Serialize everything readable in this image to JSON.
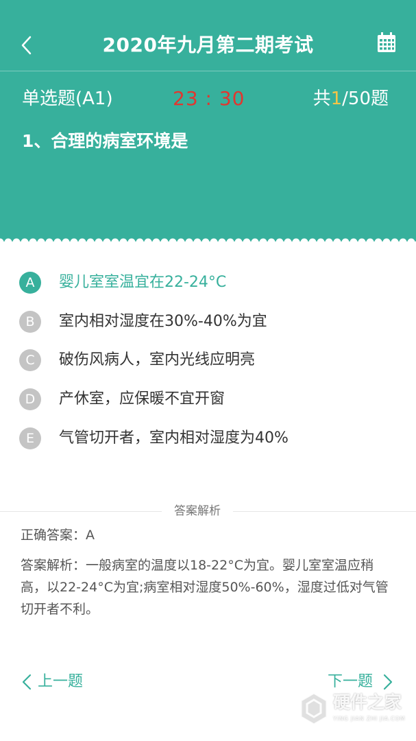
{
  "header": {
    "title": "2020年九月第二期考试",
    "question_type": "单选题(A1)",
    "timer": "23 : 30",
    "count_prefix": "共",
    "count_current": "1",
    "count_suffix": "/50题",
    "question": "1、合理的病室环境是"
  },
  "options": [
    {
      "letter": "A",
      "text": "婴儿室室温宜在22-24°C",
      "selected": true
    },
    {
      "letter": "B",
      "text": "室内相对湿度在30%-40%为宜",
      "selected": false
    },
    {
      "letter": "C",
      "text": "破伤风病人，室内光线应明亮",
      "selected": false
    },
    {
      "letter": "D",
      "text": "产休室，应保暖不宜开窗",
      "selected": false
    },
    {
      "letter": "E",
      "text": "气管切开者，室内相对湿度为40%",
      "selected": false
    }
  ],
  "analysis": {
    "title": "答案解析",
    "correct_answer": "正确答案：A",
    "explanation": "答案解析：一般病室的温度以18-22°C为宜。婴儿室室温应稍高，以22-24°C为宜;病室相对湿度50%-60%，湿度过低对气管切开者不利。"
  },
  "nav": {
    "prev_label": "上一题",
    "next_label": "下一题"
  },
  "watermark": {
    "text": "硬件之家",
    "sub": "YING JIAN ZHI JIA.COM"
  },
  "colors": {
    "primary": "#37b09c",
    "timer": "#e2362f",
    "current_count": "#f7c446",
    "option_default": "#c4c4c4"
  }
}
